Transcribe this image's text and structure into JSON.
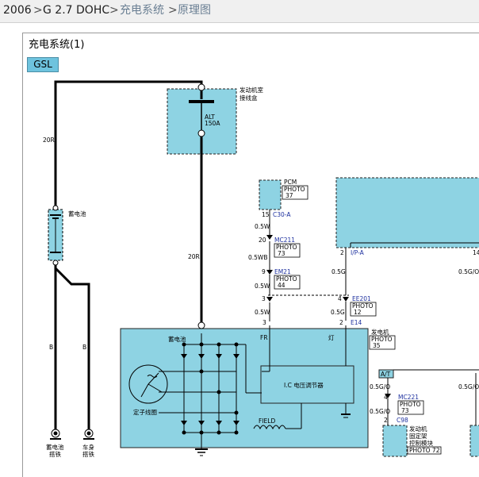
{
  "breadcrumb": {
    "year": "2006",
    "model": "G 2.7 DOHC",
    "section": "充电系统",
    "page": "原理图",
    "separator": ">"
  },
  "diagram": {
    "title": "充电系统(1)",
    "system_tag": "GSL",
    "colors": {
      "component_fill": "#8ed3e3",
      "connector_text": "#1c2f9e",
      "wire": "#000000"
    },
    "fuse_box": {
      "name_line1": "发动机室",
      "name_line2": "接线盒",
      "fuse": "ALT",
      "rating": "150A"
    },
    "battery": {
      "name": "蓄电池",
      "ground": {
        "line1": "蓄电池",
        "line2": "搭铁"
      }
    },
    "body_ground": {
      "line1": "车身",
      "line2": "搭铁"
    },
    "wire_colors": {
      "main": "20R",
      "branch": "20R",
      "ground_a": "B",
      "ground_b": "B",
      "w1": "0.5W",
      "w2": "0.5W",
      "w3": "0.5WB",
      "w4": "0.5W",
      "g1": "0.5G",
      "g2": "0.5G",
      "g3": "0.5G/O",
      "go1": "0.5G/O",
      "go2": "0.5G/O",
      "go3": "0.5G/O"
    },
    "pcm": {
      "name": "PCM",
      "photo": "PHOTO",
      "photo_no": "37",
      "pin": "15",
      "connector": "C30-A"
    },
    "connectors": [
      {
        "pin": "20",
        "name": "MC211",
        "photo": "PHOTO",
        "photo_no": "73"
      },
      {
        "pin": "9",
        "name": "EM21",
        "photo": "PHOTO",
        "photo_no": "44"
      },
      {
        "pin": "4",
        "name": "EE201",
        "photo": "PHOTO",
        "photo_no": "12"
      },
      {
        "pin": "4",
        "name": "MC221",
        "photo": "PHOTO",
        "photo_no": "73"
      }
    ],
    "pins": {
      "p3a": "3",
      "p3b": "3",
      "p2a": "2",
      "p2b": "2",
      "p14": "14"
    },
    "ip": {
      "pin": "2",
      "connector": "I/P-A"
    },
    "e14": "E14",
    "alternator": {
      "name": "发电机",
      "photo": "PHOTO",
      "photo_no": "35",
      "terminal_fr": "FR",
      "terminal_l": "灯",
      "battery_term": "蓄电池",
      "regulator": "I.C 电压调节器",
      "stator": "定子线圈",
      "field": "FIELD"
    },
    "at": "A/T",
    "mount": {
      "pin": "2",
      "connector": "C98",
      "line1": "发动机",
      "line2": "固定架",
      "line3": "控制模块",
      "photo": "PHOTO 72"
    }
  }
}
